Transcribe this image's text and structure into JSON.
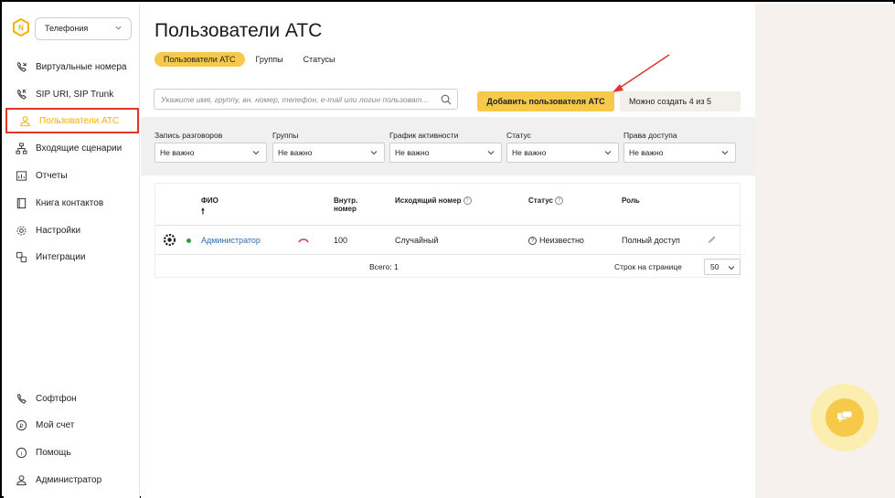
{
  "sidebar": {
    "section_select": "Телефония",
    "items": [
      {
        "label": "Виртуальные номера",
        "icon": "phone-in-icon"
      },
      {
        "label": "SIP URI, SIP Trunk",
        "icon": "phone-out-icon"
      },
      {
        "label": "Пользователи АТС",
        "icon": "user-icon",
        "active": true
      },
      {
        "label": "Входящие сценарии",
        "icon": "scenario-icon"
      },
      {
        "label": "Отчеты",
        "icon": "report-icon"
      },
      {
        "label": "Книга контактов",
        "icon": "book-icon"
      },
      {
        "label": "Настройки",
        "icon": "gear-icon"
      },
      {
        "label": "Интеграции",
        "icon": "integration-icon"
      }
    ],
    "bottom_items": [
      {
        "label": "Софтфон",
        "icon": "phone-icon"
      },
      {
        "label": "Мой счет",
        "icon": "account-icon"
      },
      {
        "label": "Помощь",
        "icon": "help-icon"
      },
      {
        "label": "Администратор",
        "icon": "user-icon"
      }
    ]
  },
  "page": {
    "title": "Пользователи АТС",
    "tabs": [
      {
        "label": "Пользователи АТС",
        "active": true
      },
      {
        "label": "Группы"
      },
      {
        "label": "Статусы"
      }
    ],
    "search_placeholder": "Укажите имя, группу, вн. номер, телефон, e-mail или логин пользоват...",
    "add_button": "Добавить пользователя АТС",
    "quota_text": "Можно создать 4 из 5"
  },
  "filters": [
    {
      "label": "Запись разговоров",
      "value": "Не важно"
    },
    {
      "label": "Группы",
      "value": "Не важно"
    },
    {
      "label": "График активности",
      "value": "Не важно"
    },
    {
      "label": "Статус",
      "value": "Не важно"
    },
    {
      "label": "Права доступа",
      "value": "Не важно"
    }
  ],
  "table": {
    "headers": {
      "name": "ФИО",
      "ext_line1": "Внутр.",
      "ext_line2": "номер",
      "outgoing": "Исходящий номер",
      "status": "Статус",
      "role": "Роль"
    },
    "rows": [
      {
        "name": "Администратор",
        "ext": "100",
        "outgoing": "Случайный",
        "status": "Неизвестно",
        "role": "Полный доступ"
      }
    ],
    "total": "Всего: 1",
    "rows_per_page_label": "Строк на странице",
    "rows_per_page": "50"
  },
  "colors": {
    "accent": "#f6c94a",
    "active_text": "#f3b200",
    "highlight_border": "#e0352b",
    "link": "#2f6db5"
  }
}
